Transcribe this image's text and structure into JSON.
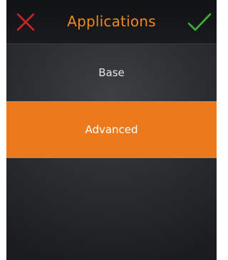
{
  "header": {
    "title": "Applications",
    "cancel_icon": "close-x-icon",
    "confirm_icon": "checkmark-icon"
  },
  "list": {
    "items": [
      {
        "label": "Base",
        "selected": false
      },
      {
        "label": "Advanced",
        "selected": true
      }
    ]
  },
  "colors": {
    "accent": "#ec7a1c",
    "title": "#f08a1e",
    "cancel": "#d0252b",
    "confirm": "#3fae3c",
    "background": "#2c2f31"
  }
}
